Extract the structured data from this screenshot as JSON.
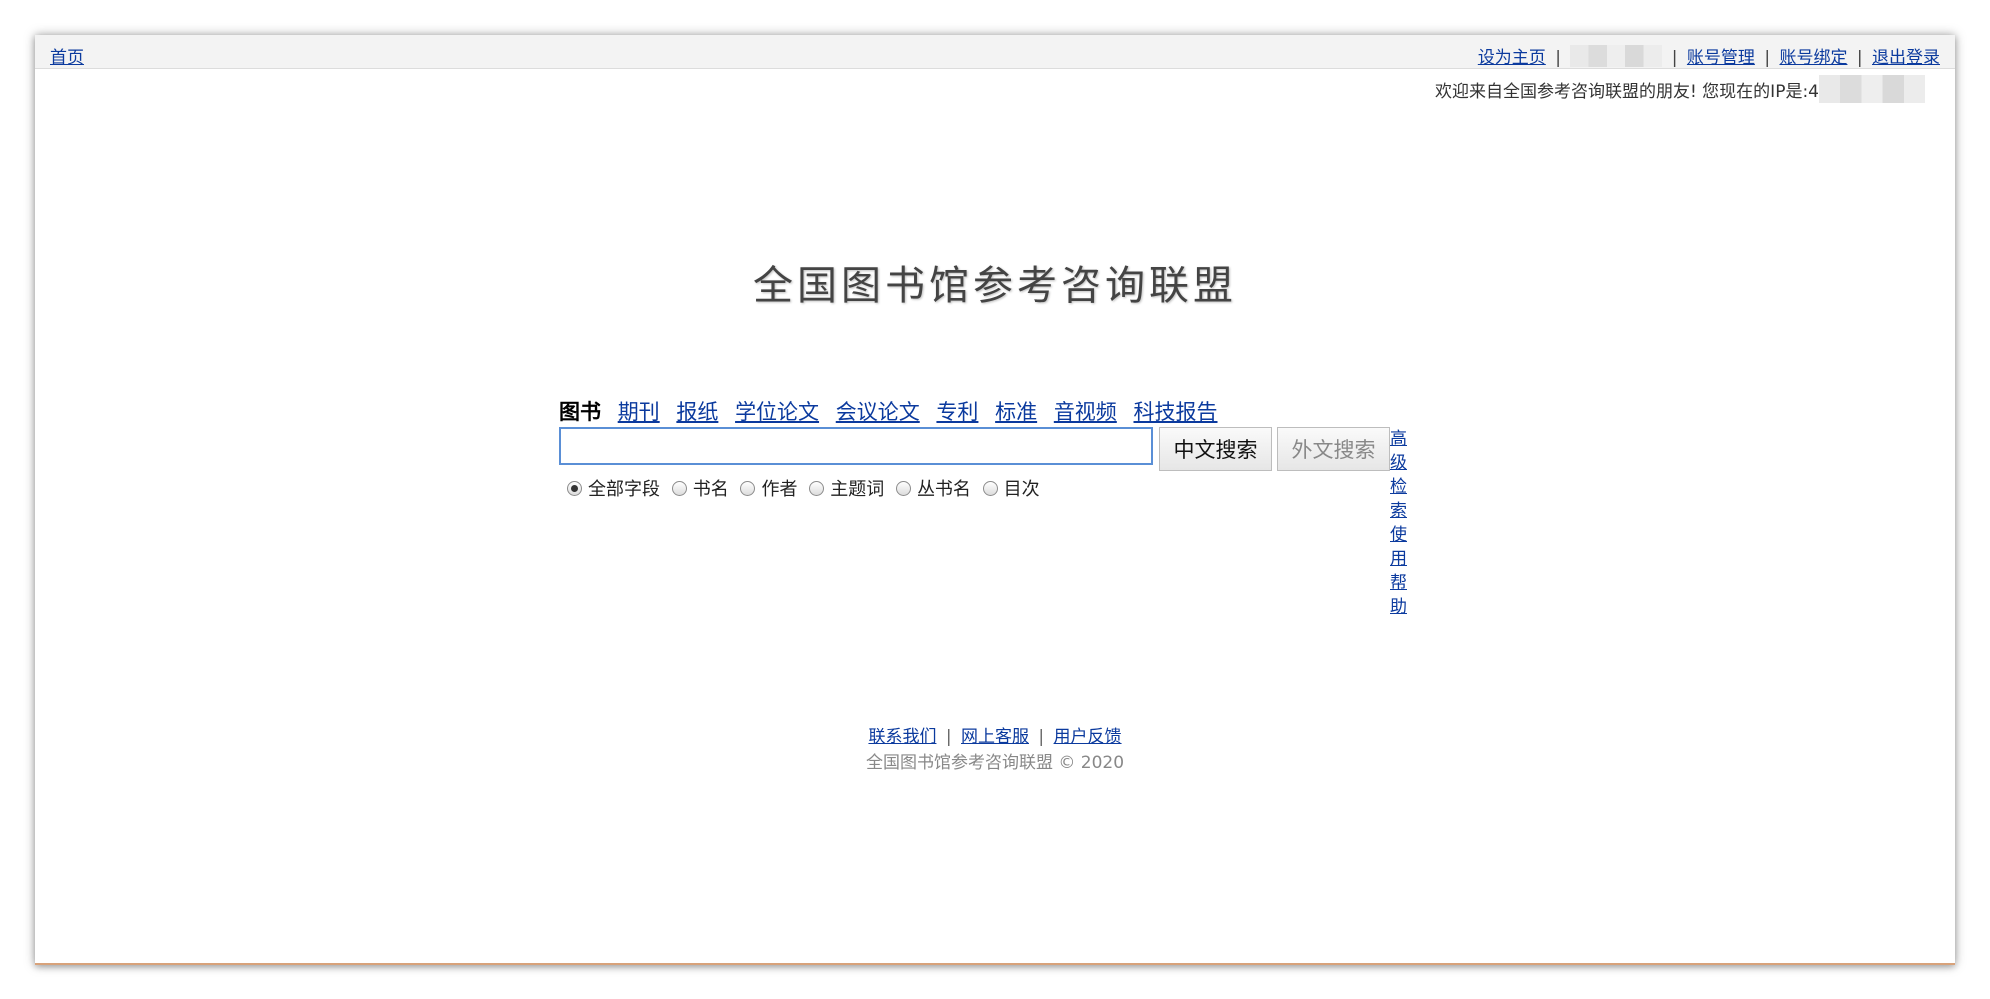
{
  "topbar": {
    "home": "首页",
    "links": [
      "设为主页",
      "账号管理",
      "账号绑定",
      "退出登录"
    ],
    "separator": "|"
  },
  "welcome": {
    "text": "欢迎来自全国参考咨询联盟的朋友! 您现在的IP是:4"
  },
  "logo": {
    "text": "全国图书馆参考咨询联盟"
  },
  "tabs": {
    "active": "图书",
    "items": [
      "期刊",
      "报纸",
      "学位论文",
      "会议论文",
      "专利",
      "标准",
      "音视频",
      "科技报告"
    ]
  },
  "search": {
    "value": "",
    "buttons": {
      "chinese": "中文搜索",
      "foreign": "外文搜索"
    },
    "advanced": "高级检索",
    "help": "使用帮助"
  },
  "options": {
    "selected": 0,
    "items": [
      "全部字段",
      "书名",
      "作者",
      "主题词",
      "丛书名",
      "目次"
    ]
  },
  "footer": {
    "links": [
      "联系我们",
      "网上客服",
      "用户反馈"
    ],
    "separator": "|",
    "copyright": "全国图书馆参考咨询联盟 © 2020"
  }
}
